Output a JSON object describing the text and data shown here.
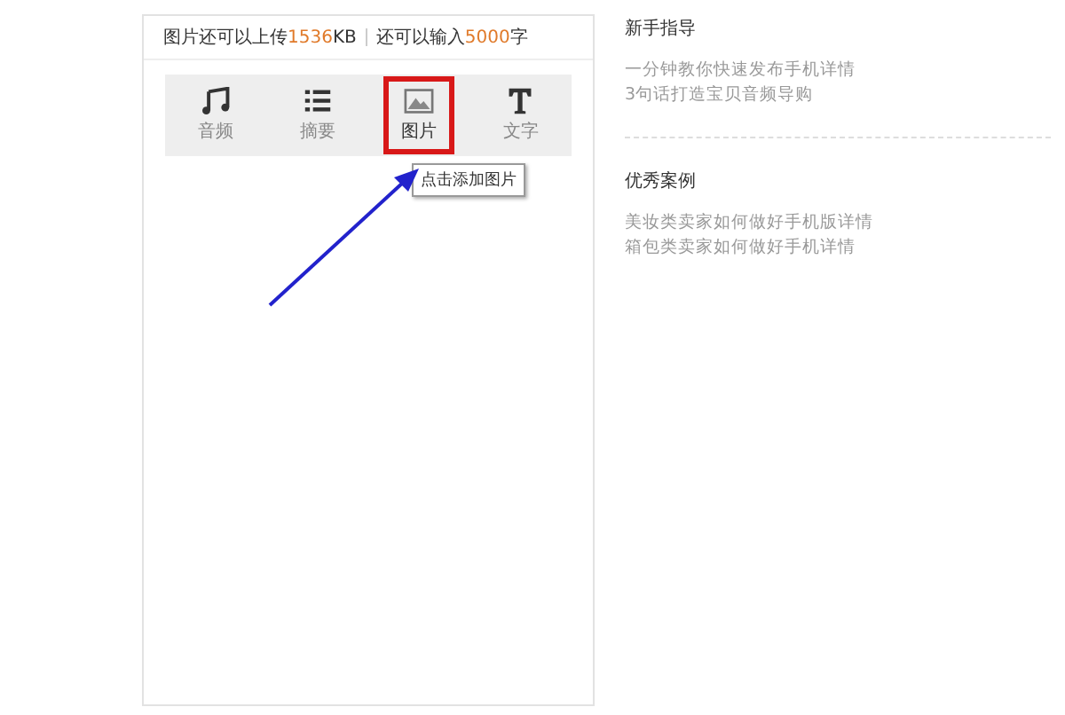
{
  "editor": {
    "quota": {
      "upload_prefix": "图片还可以上传",
      "upload_amount": "1536",
      "upload_unit": "KB",
      "input_prefix": "还可以输入",
      "input_amount": "5000",
      "input_unit": "字"
    },
    "tools": [
      {
        "kind": "music",
        "label": "音频",
        "selected": false
      },
      {
        "kind": "list",
        "label": "摘要",
        "selected": false
      },
      {
        "kind": "image",
        "label": "图片",
        "selected": true
      },
      {
        "kind": "text",
        "label": "文字",
        "selected": false
      }
    ],
    "tooltip": "点击添加图片"
  },
  "guides": [
    {
      "title": "新手指导",
      "links": [
        "一分钟教你快速发布手机详情",
        "3句话打造宝贝音频导购"
      ]
    },
    {
      "title": "优秀案例",
      "links": [
        "美妆类卖家如何做好手机版详情",
        "箱包类卖家如何做好手机详情"
      ]
    }
  ]
}
